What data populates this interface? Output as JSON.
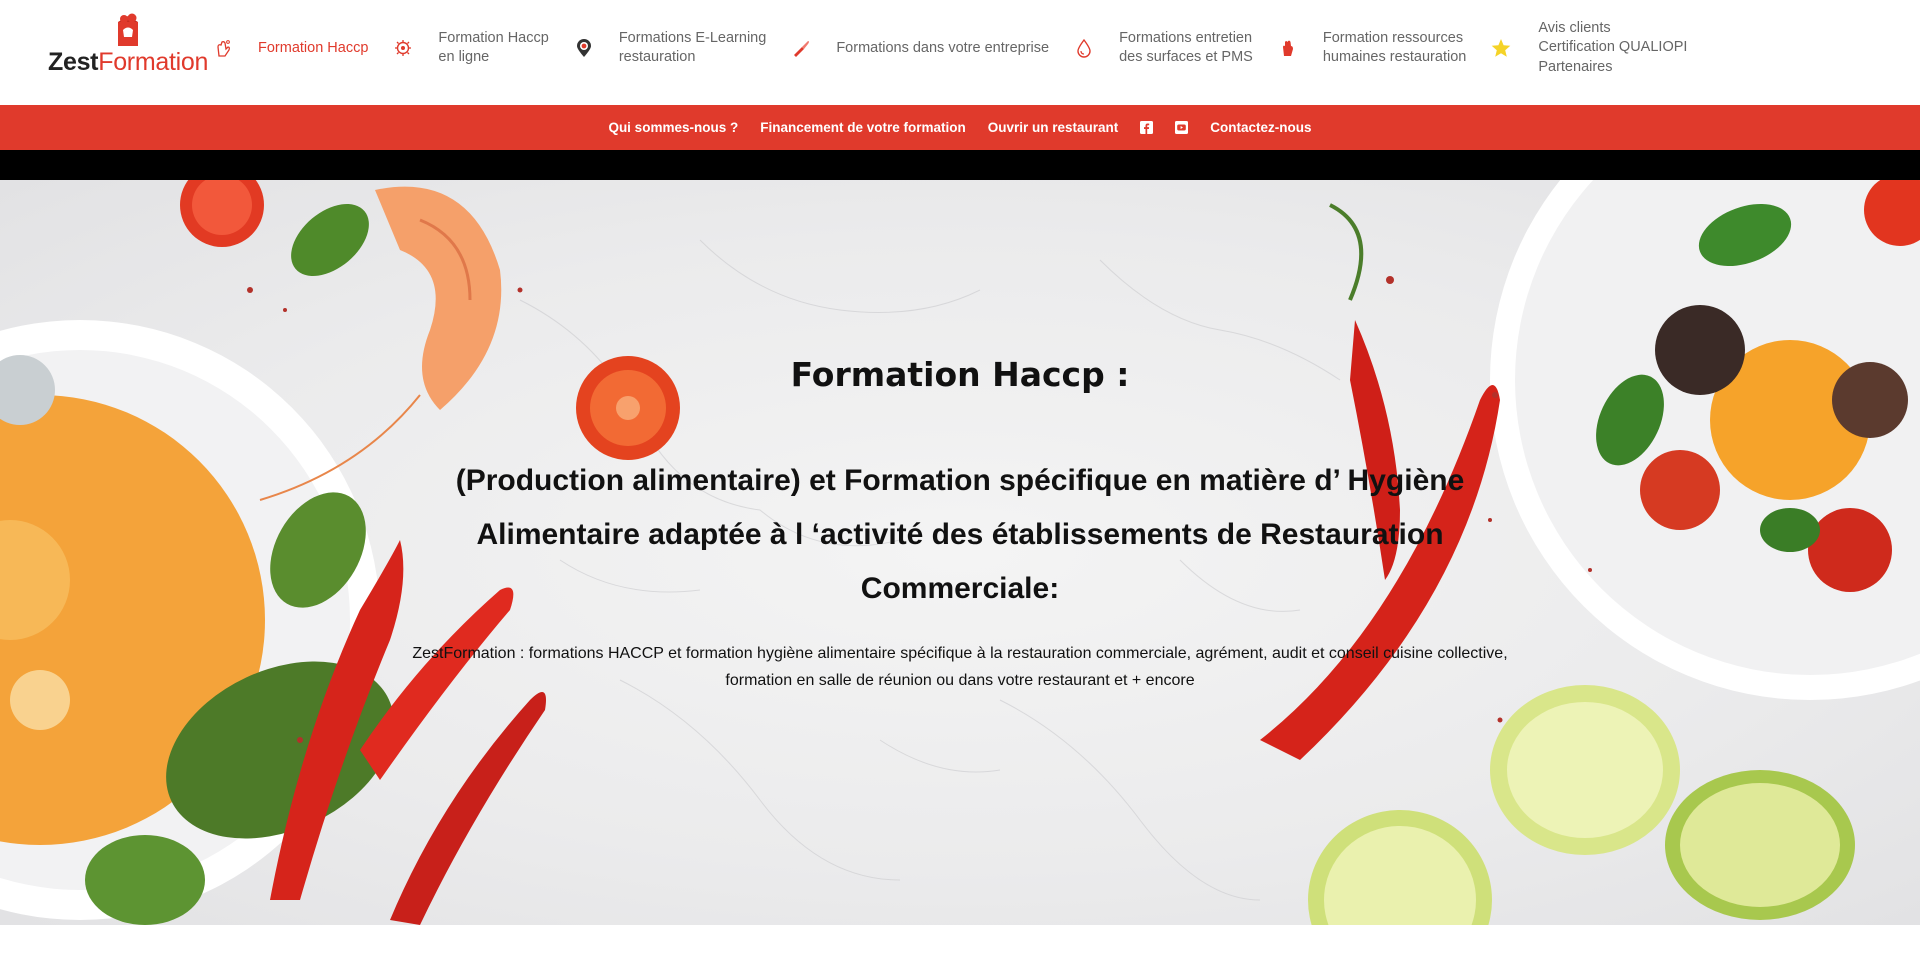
{
  "brand": {
    "name_part1": "Zest",
    "name_part2": "Formation",
    "accent_color": "#e03a2c"
  },
  "nav": {
    "items": [
      {
        "icon": "hand-wash-icon",
        "line1": "Formation Haccp",
        "line2": "",
        "active": true
      },
      {
        "icon": "virus-icon",
        "line1": "Formation Haccp",
        "line2": "en ligne",
        "active": false
      },
      {
        "icon": "location-pin-icon",
        "line1": "Formations E-Learning",
        "line2": "restauration",
        "active": false
      },
      {
        "icon": "chef-knife-icon",
        "line1": "Formations dans votre entreprise",
        "line2": "",
        "active": false
      },
      {
        "icon": "water-drop-icon",
        "line1": "Formations entretien",
        "line2": "des surfaces et PMS",
        "active": false
      },
      {
        "icon": "hand-icon",
        "line1": "Formation ressources",
        "line2": "humaines restauration",
        "active": false
      }
    ],
    "extra_icon": "star-icon",
    "extra_links": [
      "Avis clients",
      "Certification QUALIOPI",
      "Partenaires"
    ]
  },
  "subnav": {
    "links": [
      "Qui sommes-nous ?",
      "Financement de votre formation",
      "Ouvrir un restaurant"
    ],
    "social": [
      "facebook-icon",
      "youtube-icon"
    ],
    "contact": "Contactez-nous"
  },
  "hero": {
    "title": "Formation Haccp :",
    "subtitle": "(Production alimentaire) et Formation spécifique en matière d’ Hygiène Alimentaire adaptée à l ‘activité des établissements de Restauration Commerciale:",
    "desc_line1": "ZestFormation : formations HACCP et formation hygiène alimentaire spécifique à la restauration commerciale, agrément, audit et conseil cuisine collective,",
    "desc_line2": "formation en salle de réunion ou dans votre restaurant et + encore"
  }
}
